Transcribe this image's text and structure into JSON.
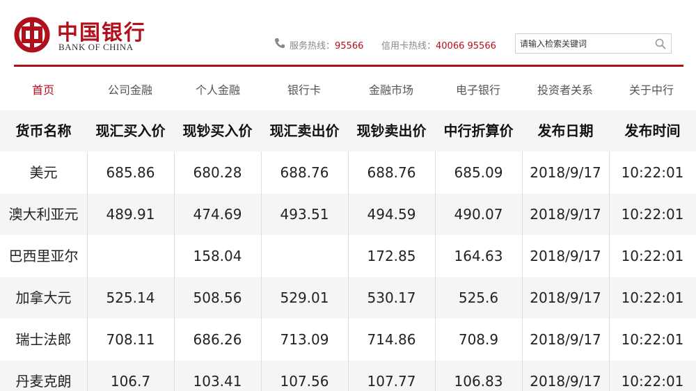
{
  "brand": {
    "name_cn": "中国银行",
    "name_en": "BANK OF CHINA",
    "color": "#b0101c"
  },
  "hotlines": [
    {
      "label": "服务热线：",
      "number": "95566"
    },
    {
      "label": "信用卡热线：",
      "number": "40066 95566"
    }
  ],
  "search": {
    "placeholder": "请输入检索关键词",
    "icon": "search-icon"
  },
  "nav": {
    "items": [
      {
        "label": "首页",
        "active": true
      },
      {
        "label": "公司金融"
      },
      {
        "label": "个人金融"
      },
      {
        "label": "银行卡"
      },
      {
        "label": "金融市场"
      },
      {
        "label": "电子银行"
      },
      {
        "label": "投资者关系"
      },
      {
        "label": "关于中行"
      }
    ]
  },
  "table": {
    "headers": [
      "货币名称",
      "现汇买入价",
      "现钞买入价",
      "现汇卖出价",
      "现钞卖出价",
      "中行折算价",
      "发布日期",
      "发布时间"
    ],
    "rows": [
      [
        "美元",
        "685.86",
        "680.28",
        "688.76",
        "688.76",
        "685.09",
        "2018/9/17",
        "10:22:01"
      ],
      [
        "澳大利亚元",
        "489.91",
        "474.69",
        "493.51",
        "494.59",
        "490.07",
        "2018/9/17",
        "10:22:01"
      ],
      [
        "巴西里亚尔",
        "",
        "158.04",
        "",
        "172.85",
        "164.63",
        "2018/9/17",
        "10:22:01"
      ],
      [
        "加拿大元",
        "525.14",
        "508.56",
        "529.01",
        "530.17",
        "525.6",
        "2018/9/17",
        "10:22:01"
      ],
      [
        "瑞士法郎",
        "708.11",
        "686.26",
        "713.09",
        "714.86",
        "708.9",
        "2018/9/17",
        "10:22:01"
      ],
      [
        "丹麦克朗",
        "106.7",
        "103.41",
        "107.56",
        "107.77",
        "106.83",
        "2018/9/17",
        "10:22:01"
      ]
    ]
  }
}
